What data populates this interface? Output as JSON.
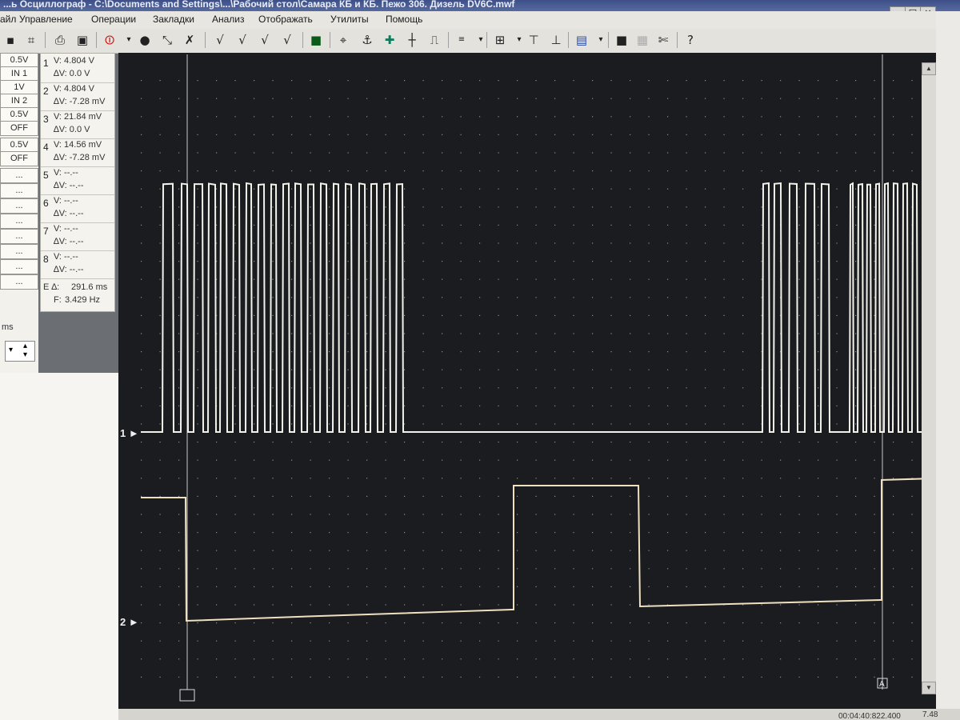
{
  "window": {
    "title": "...ь Осциллограф - C:\\Documents and Settings\\...\\Рабочий стол\\Самара КБ и КБ. Пежо 306. Дизель DV6C.mwf",
    "buttons": [
      "_",
      "□",
      "×"
    ]
  },
  "menu": [
    "айл",
    "Управление",
    "Операции",
    "Закладки",
    "Анализ",
    "Отображать",
    "Утилиты",
    "Помощь"
  ],
  "toolbar_icons": [
    "save-icon",
    "open-icon",
    "print-icon",
    "export-icon",
    "stop-icon",
    "record-icon",
    "autoscale-icon",
    "tools-icon",
    "check-icon",
    "check-plus-icon",
    "check-double-icon",
    "check-minus-icon",
    "display-icon",
    "cursor-icon",
    "trigger-icon",
    "marker-icon",
    "probe-icon",
    "slope-icon",
    "mem-icon",
    "zoom-icon",
    "zoom-in-icon",
    "zoom-out-icon",
    "window-icon",
    "color-icon",
    "black-icon",
    "grid-icon",
    "help-icon"
  ],
  "channels": [
    {
      "range": "0.5V",
      "input": "IN 1"
    },
    {
      "range": "1V",
      "input": "IN 2"
    },
    {
      "range": "0.5V",
      "input": "OFF"
    },
    {
      "range": "0.5V",
      "input": "OFF"
    }
  ],
  "empty_cells": [
    "...",
    "...",
    "...",
    "...",
    "...",
    "...",
    "...",
    "..."
  ],
  "measurements": [
    {
      "num": "1",
      "v": "V:  4.804 V",
      "dv": "∆V:   0.0 V"
    },
    {
      "num": "2",
      "v": "V:  4.804 V",
      "dv": "∆V:  -7.28 mV"
    },
    {
      "num": "3",
      "v": "V: 21.84 mV",
      "dv": "∆V:   0.0 V"
    },
    {
      "num": "4",
      "v": "V: 14.56 mV",
      "dv": "∆V:  -7.28 mV"
    },
    {
      "num": "5",
      "v": "V:   --.--",
      "dv": "∆V:   --.--"
    },
    {
      "num": "6",
      "v": "V:   --.--",
      "dv": "∆V:   --.--"
    },
    {
      "num": "7",
      "v": "V:   --.--",
      "dv": "∆V:   --.--"
    },
    {
      "num": "8",
      "v": "V:   --.--",
      "dv": "∆V:   --.--"
    }
  ],
  "timing": {
    "e_label": "E ∆:",
    "e_value": "291.6 ms",
    "f_label": "F:",
    "f_value": "3.429 Hz"
  },
  "left_ms": "ms",
  "markers": {
    "ch1": "1",
    "ch2": "2",
    "cursor_a": "A"
  },
  "status": {
    "time": "00:04:40:822.400",
    "zoom": "7.48"
  },
  "colors": {
    "screen": "#1a1c20",
    "grid": "#8f8f8f",
    "trace1": "#f2f2ea",
    "trace2": "#efe0c0"
  },
  "trace1_transitions": [
    203,
    216,
    226,
    234,
    242,
    253,
    260,
    269,
    275,
    283,
    291,
    299,
    307,
    314,
    322,
    330,
    338,
    345,
    353,
    361,
    368,
    376,
    384,
    392,
    400,
    408,
    416,
    423,
    431,
    439,
    448,
    456,
    463,
    471,
    479,
    487,
    495,
    503,
    953,
    961,
    967,
    976,
    986,
    996,
    1006,
    1018,
    1026,
    1036,
    1062,
    1066,
    1072,
    1078,
    1083,
    1088,
    1094,
    1099,
    1105,
    1110,
    1116,
    1122,
    1128,
    1134,
    1140,
    1146,
    1153,
    1159
  ],
  "trace2": {
    "high_start": 642,
    "high_end": 798
  }
}
